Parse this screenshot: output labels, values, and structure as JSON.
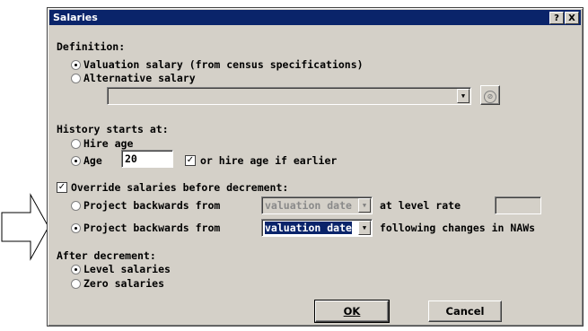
{
  "window": {
    "title": "Salaries",
    "help_label": "?",
    "close_label": "X"
  },
  "definition": {
    "heading": "Definition:",
    "valuation_label": "Valuation salary (from census specifications)",
    "alternative_label": "Alternative salary",
    "alternative_value": "",
    "selected": "valuation"
  },
  "history": {
    "heading": "History starts at:",
    "hire_label": "Hire age",
    "age_label": "Age",
    "age_value": "20",
    "hire_earlier_label": "or hire age if earlier",
    "hire_earlier_checked": true,
    "selected": "age"
  },
  "override": {
    "label": "Override salaries before decrement:",
    "checked": true,
    "project1_label": "Project backwards from",
    "project1_select": "valuation date",
    "level_rate_label": "at level rate",
    "level_rate_value": "",
    "project2_label": "Project backwards from",
    "project2_select": "valuation date",
    "naw_label": "following changes in NAWs",
    "selected": "project2"
  },
  "after": {
    "heading": "After decrement:",
    "level_label": "Level salaries",
    "zero_label": "Zero salaries",
    "selected": "level"
  },
  "buttons": {
    "ok_label": "OK",
    "cancel_label": "Cancel"
  },
  "colors": {
    "titlebar": "#0a246a",
    "dialog": "#d4d0c8",
    "selection": "#0a246a"
  }
}
